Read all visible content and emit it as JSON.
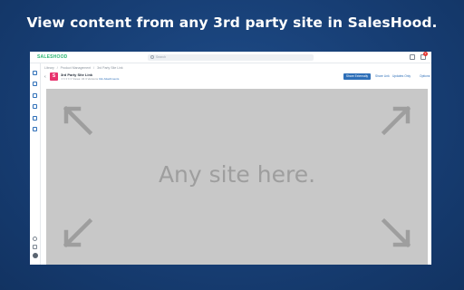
{
  "headline": "View content from any 3rd party site in SalesHood.",
  "app": {
    "logo": "SALESHOOD",
    "search_placeholder": "Search",
    "notification_count": "2",
    "breadcrumb": [
      "Library",
      "/",
      "Product Management",
      "/",
      "3rd Party Site Link"
    ],
    "content": {
      "title": "3rd Party Site Link",
      "rating": "★★★★★",
      "views": "Views: 34",
      "shares": "3 Versions",
      "edit_link": "Info",
      "attachments": "Attachments"
    },
    "actions": {
      "primary": "Share Externally",
      "share_link": "Share Link",
      "updates": "Updates Only",
      "options": "Options"
    },
    "placeholder_text": "Any site here."
  },
  "colors": {
    "accent": "#2e6fb8",
    "brand_green": "#2bb673",
    "doc_icon": "#e8336e",
    "background": "#173e74",
    "frame": "#c8c8c8",
    "arrows": "#9e9e9e"
  },
  "icons": {
    "sidebar": [
      "home-icon",
      "chat-icon",
      "library-icon",
      "megaphone-icon",
      "inbox-icon",
      "chart-icon"
    ],
    "sidebar_footer": [
      "help-icon",
      "menu-icon",
      "user-avatar"
    ],
    "frame_corners": [
      "expand-top-left-icon",
      "expand-top-right-icon",
      "expand-bottom-left-icon",
      "expand-bottom-right-icon"
    ]
  }
}
